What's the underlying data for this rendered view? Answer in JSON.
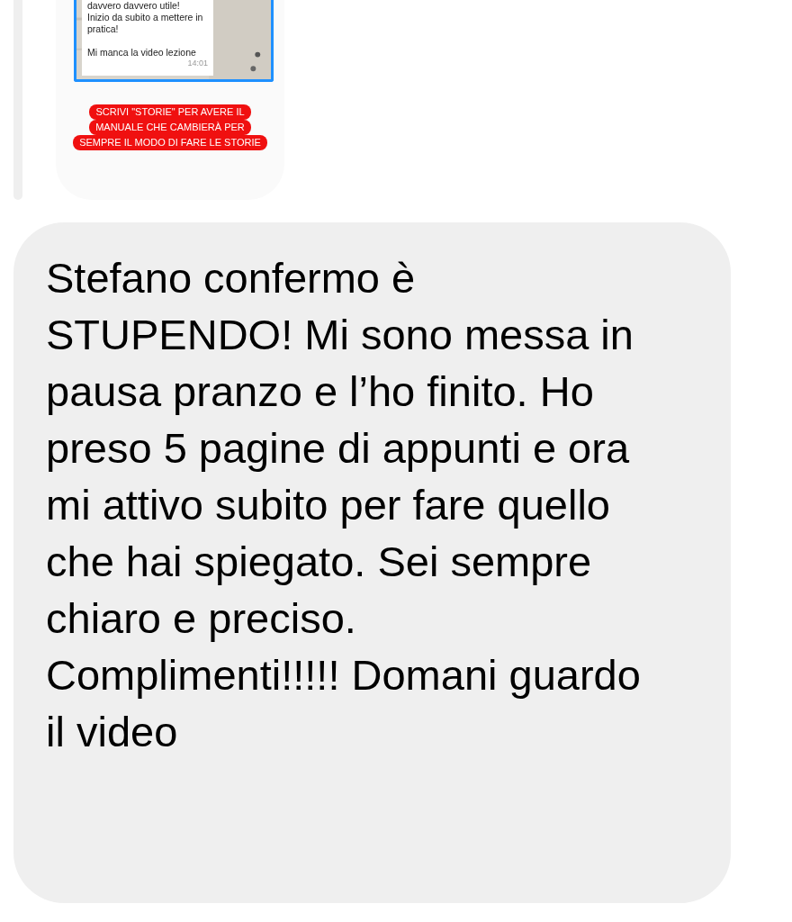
{
  "shared_story": {
    "quoted_message": {
      "paragraphs": [
        [
          "davvero davvero utile!",
          "Inizio da subito a mettere in",
          "pratica!"
        ],
        [
          "Mi manca la video lezione"
        ]
      ],
      "time": "14:01"
    },
    "caption_lines": [
      "SCRIVI \"STORIE\" PER AVERE IL",
      "MANUALE CHE CAMBIERÀ PER",
      "SEMPRE IL MODO DI FARE LE STORIE"
    ]
  },
  "message": {
    "text": "Stefano confermo è STUPENDO! Mi sono messa in pausa pranzo e l’ho finito. Ho preso 5 pagine di appunti e ora mi attivo subito per fare quello che hai spiegato. Sei sempre chiaro e preciso. Complimenti!!!!! Domani guardo il video"
  }
}
